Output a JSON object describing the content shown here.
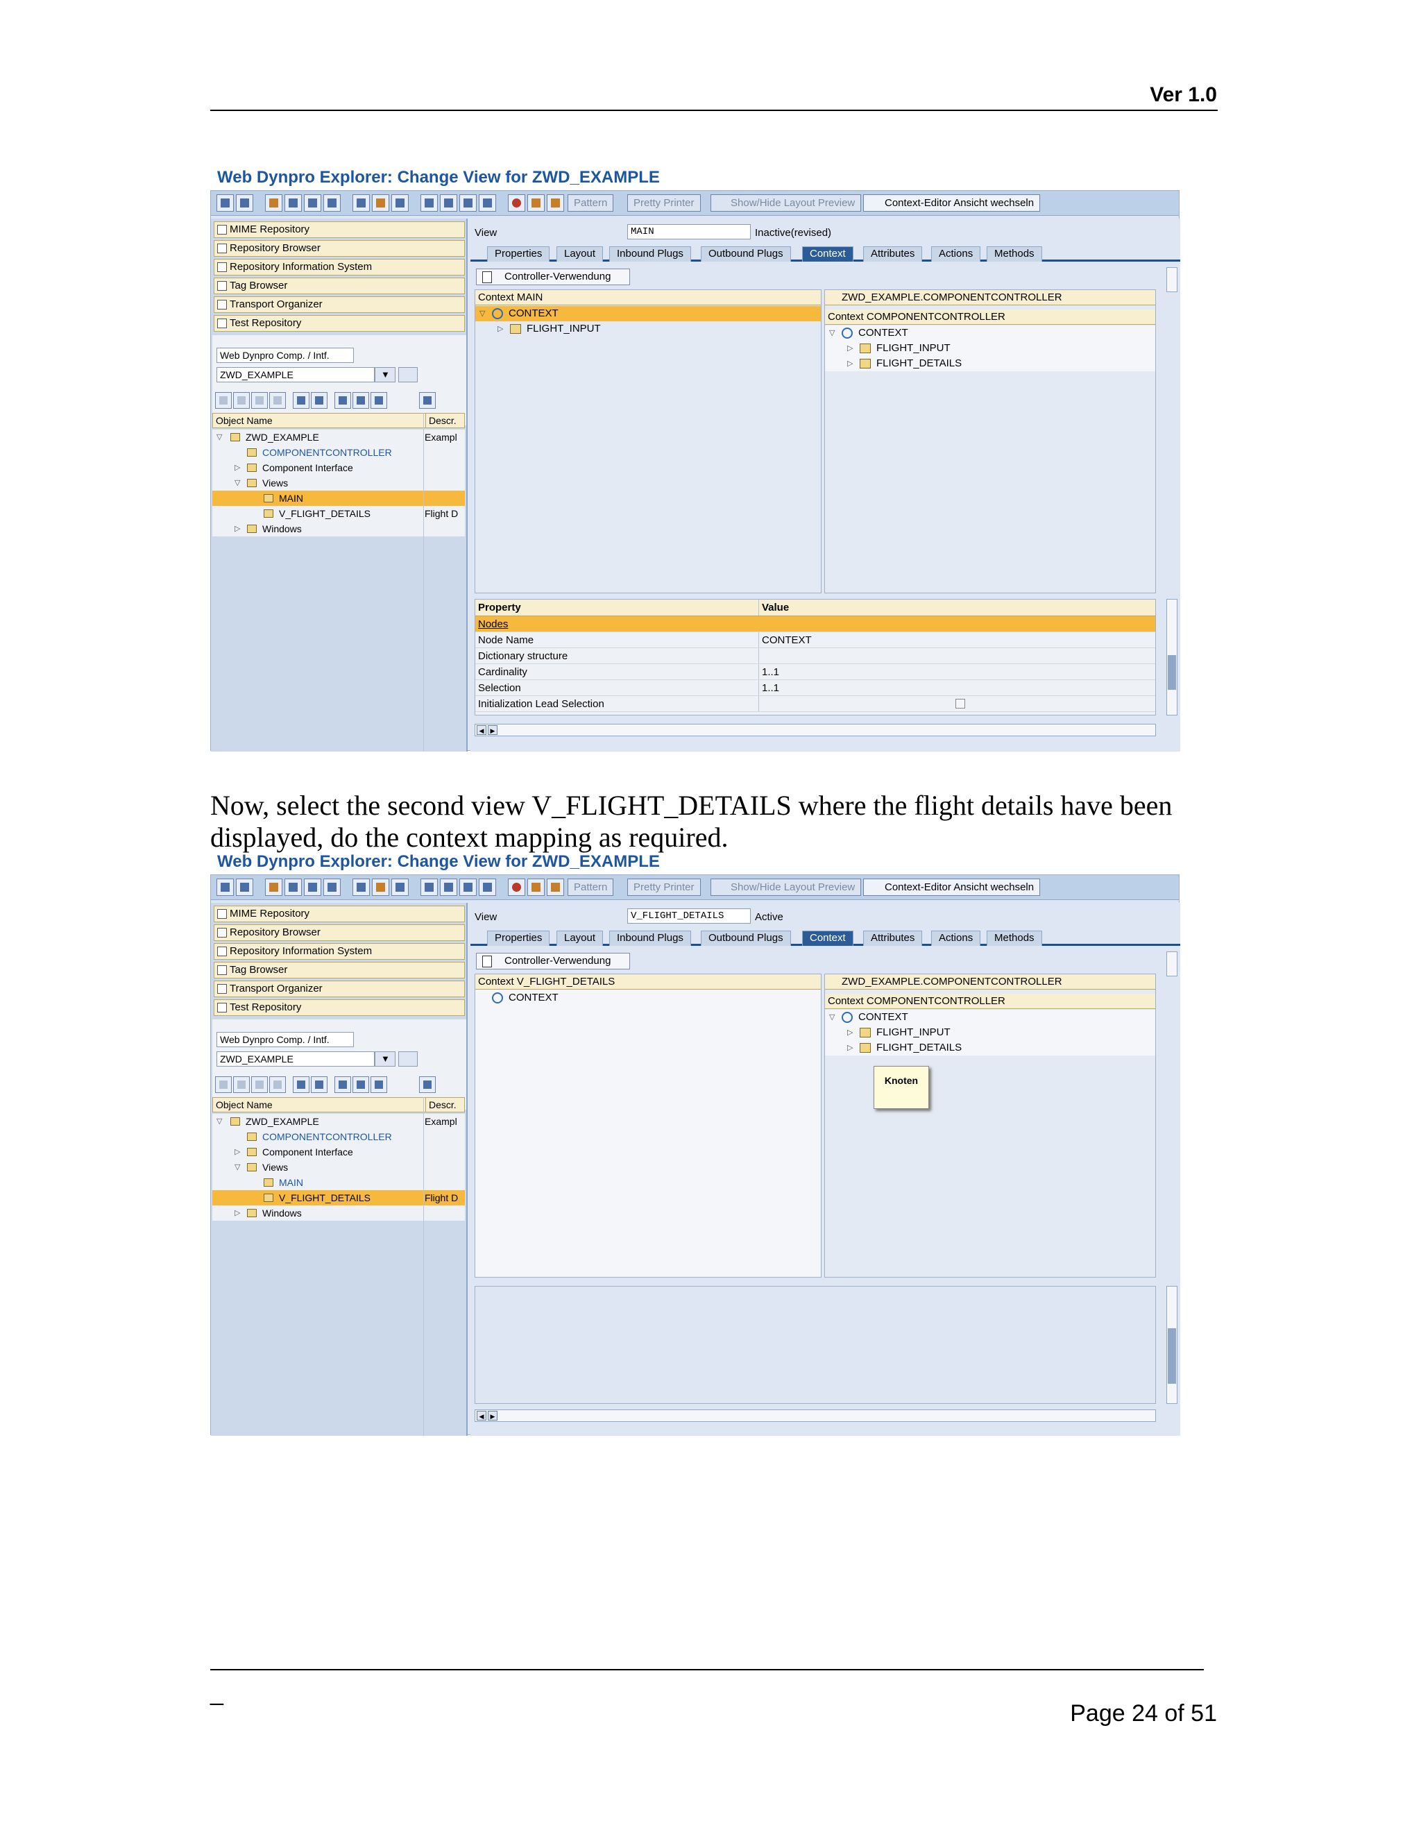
{
  "header": {
    "version": "Ver 1.0"
  },
  "footer": {
    "dash": "_",
    "page": "Page 24 of 51"
  },
  "paragraph": "Now, select the second view V_FLIGHT_DETAILS where the flight details have been displayed, do the context mapping as required.",
  "shot1": {
    "title": "Web Dynpro Explorer: Change View for ZWD_EXAMPLE",
    "toolbar": {
      "pattern": "Pattern",
      "pretty": "Pretty Printer",
      "showhide": "Show/Hide Layout Preview",
      "ctxeditor": "Context-Editor Ansicht wechseln"
    },
    "nav": [
      "MIME Repository",
      "Repository Browser",
      "Repository Information System",
      "Tag Browser",
      "Transport Organizer",
      "Test Repository"
    ],
    "selector": {
      "label": "Web Dynpro Comp. / Intf.",
      "value": "ZWD_EXAMPLE"
    },
    "objhdr": {
      "name": "Object Name",
      "desc": "Descr."
    },
    "tree": [
      {
        "label": "ZWD_EXAMPLE",
        "desc": "Exampl"
      },
      {
        "label": "COMPONENTCONTROLLER",
        "desc": ""
      },
      {
        "label": "Component Interface",
        "desc": ""
      },
      {
        "label": "Views",
        "desc": ""
      },
      {
        "label": "MAIN",
        "desc": ""
      },
      {
        "label": "V_FLIGHT_DETAILS",
        "desc": "Flight D"
      },
      {
        "label": "Windows",
        "desc": ""
      }
    ],
    "view": {
      "label": "View",
      "value": "MAIN",
      "status": "Inactive(revised)"
    },
    "tabs": [
      "Properties",
      "Layout",
      "Inbound Plugs",
      "Outbound Plugs",
      "Context",
      "Attributes",
      "Actions",
      "Methods"
    ],
    "controller_btn": "Controller-Verwendung",
    "left_ctx": {
      "header": "Context MAIN",
      "nodes": [
        "CONTEXT",
        "FLIGHT_INPUT"
      ]
    },
    "right_ctx": {
      "header": "ZWD_EXAMPLE.COMPONENTCONTROLLER",
      "header2": "Context COMPONENTCONTROLLER",
      "nodes": [
        "CONTEXT",
        "FLIGHT_INPUT",
        "FLIGHT_DETAILS"
      ]
    },
    "props": {
      "col1": "Property",
      "col2": "Value",
      "rows": [
        {
          "k": "Nodes",
          "v": ""
        },
        {
          "k": "Node Name",
          "v": "CONTEXT"
        },
        {
          "k": "Dictionary structure",
          "v": ""
        },
        {
          "k": "Cardinality",
          "v": "1..1"
        },
        {
          "k": "Selection",
          "v": "1..1"
        },
        {
          "k": "Initialization Lead Selection",
          "v": ""
        }
      ]
    }
  },
  "shot2": {
    "title": "Web Dynpro Explorer: Change View for ZWD_EXAMPLE",
    "toolbar": {
      "pattern": "Pattern",
      "pretty": "Pretty Printer",
      "showhide": "Show/Hide Layout Preview",
      "ctxeditor": "Context-Editor Ansicht wechseln"
    },
    "nav": [
      "MIME Repository",
      "Repository Browser",
      "Repository Information System",
      "Tag Browser",
      "Transport Organizer",
      "Test Repository"
    ],
    "selector": {
      "label": "Web Dynpro Comp. / Intf.",
      "value": "ZWD_EXAMPLE"
    },
    "objhdr": {
      "name": "Object Name",
      "desc": "Descr."
    },
    "tree": [
      {
        "label": "ZWD_EXAMPLE",
        "desc": "Exampl"
      },
      {
        "label": "COMPONENTCONTROLLER",
        "desc": ""
      },
      {
        "label": "Component Interface",
        "desc": ""
      },
      {
        "label": "Views",
        "desc": ""
      },
      {
        "label": "MAIN",
        "desc": ""
      },
      {
        "label": "V_FLIGHT_DETAILS",
        "desc": "Flight D"
      },
      {
        "label": "Windows",
        "desc": ""
      }
    ],
    "view": {
      "label": "View",
      "value": "V_FLIGHT_DETAILS",
      "status": "Active"
    },
    "tabs": [
      "Properties",
      "Layout",
      "Inbound Plugs",
      "Outbound Plugs",
      "Context",
      "Attributes",
      "Actions",
      "Methods"
    ],
    "controller_btn": "Controller-Verwendung",
    "left_ctx": {
      "header": "Context V_FLIGHT_DETAILS",
      "nodes": [
        "CONTEXT"
      ]
    },
    "right_ctx": {
      "header": "ZWD_EXAMPLE.COMPONENTCONTROLLER",
      "header2": "Context COMPONENTCONTROLLER",
      "nodes": [
        "CONTEXT",
        "FLIGHT_INPUT",
        "FLIGHT_DETAILS"
      ]
    },
    "tooltip": "Knoten"
  }
}
